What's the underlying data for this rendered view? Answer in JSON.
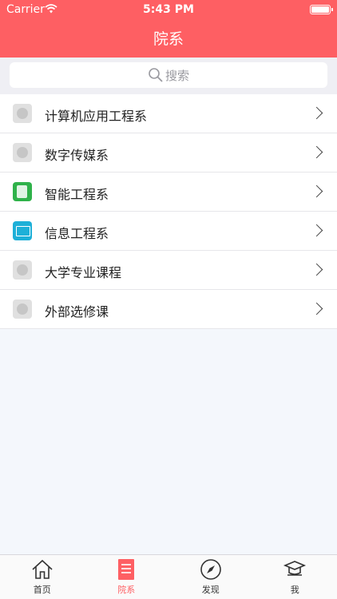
{
  "status_bar": {
    "carrier": "Carrier",
    "time": "5:43 PM"
  },
  "nav": {
    "title": "院系"
  },
  "search": {
    "placeholder": "搜索"
  },
  "departments": [
    {
      "label": "计算机应用工程系",
      "icon": "placeholder-icon"
    },
    {
      "label": "数字传媒系",
      "icon": "placeholder-icon"
    },
    {
      "label": "智能工程系",
      "icon": "green-book-icon"
    },
    {
      "label": "信息工程系",
      "icon": "cyan-screen-icon"
    },
    {
      "label": "大学专业课程",
      "icon": "placeholder-icon"
    },
    {
      "label": "外部选修课",
      "icon": "placeholder-icon"
    }
  ],
  "tabs": [
    {
      "label": "首页",
      "icon": "home-icon",
      "active": false
    },
    {
      "label": "院系",
      "icon": "list-icon",
      "active": true
    },
    {
      "label": "发现",
      "icon": "compass-icon",
      "active": false
    },
    {
      "label": "我",
      "icon": "graduation-cap-icon",
      "active": false
    }
  ],
  "colors": {
    "accent": "#fe5f63",
    "background": "#f4f7fc"
  }
}
